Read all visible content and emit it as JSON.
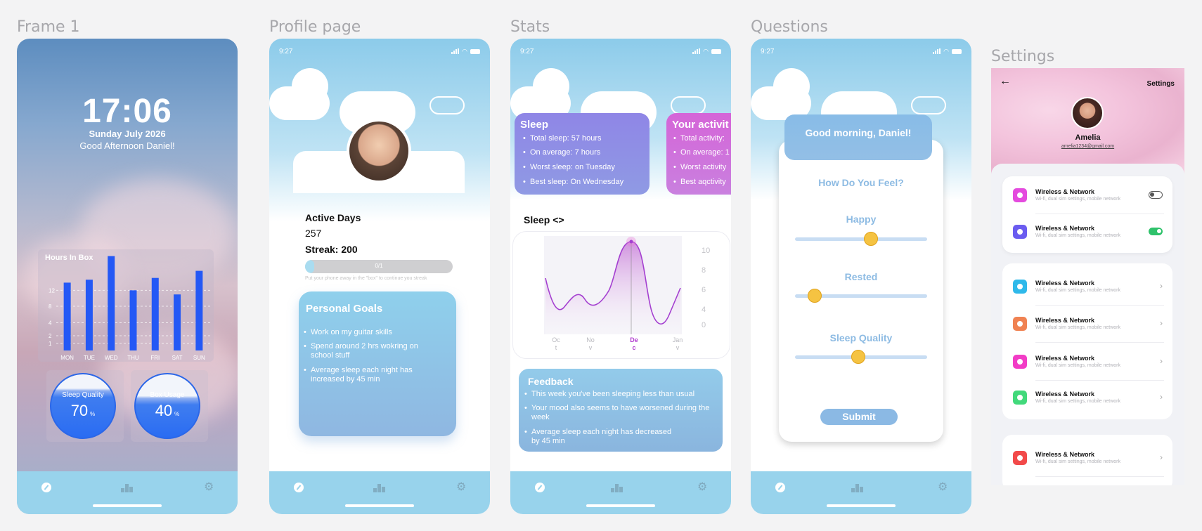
{
  "frames": {
    "frame1": "Frame 1",
    "profile": "Profile page",
    "stats": "Stats",
    "questions": "Questions",
    "settings": "Settings"
  },
  "status_time": "9:27",
  "frame1": {
    "time": "17:06",
    "date": "Sunday July 2026",
    "greeting": "Good Afternoon Daniel!",
    "chart_title": "Hours In Box",
    "gauges": [
      {
        "label": "Sleep Quality",
        "value": "70",
        "unit": "%",
        "fill": 0.7
      },
      {
        "label": "Box Usage",
        "value": "40",
        "unit": "%",
        "fill": 0.4
      }
    ]
  },
  "chart_data": [
    {
      "type": "bar",
      "title": "Hours In Box",
      "categories": [
        "MON",
        "TUE",
        "WED",
        "THU",
        "FRI",
        "SAT",
        "SUN"
      ],
      "values": [
        11.5,
        12,
        16,
        10.2,
        12.3,
        9.5,
        13.5
      ],
      "y_ticks": [
        "1",
        "2",
        "4",
        "8",
        "12"
      ],
      "grid": true
    },
    {
      "type": "line",
      "title": "Sleep <>",
      "categories": [
        "Oc\nt",
        "No\nv",
        "De\nc",
        "Jan\nv"
      ],
      "y_ticks": [
        "10",
        "8",
        "6",
        "4",
        "0"
      ],
      "highlight": "De\nc"
    }
  ],
  "profile": {
    "active_days_label": "Active Days",
    "active_days_value": "257",
    "streak": "Streak: 200",
    "progress_text": "0/1",
    "progress_fraction": 0.06,
    "hint": "Put your phone away in the \"box\" to continue you streak",
    "goals_title": "Personal Goals",
    "goals": [
      "Work on my guitar skills",
      "Spend around 2 hrs wokring on school stuff",
      "Average sleep each night has increased by 45 min"
    ]
  },
  "stats": {
    "sleep_card": {
      "title": "Sleep",
      "lines": [
        "Total sleep:  57 hours",
        "On average: 7 hours",
        "Worst sleep: on Tuesday",
        "Best sleep: On Wednesday"
      ]
    },
    "activity_card": {
      "title": "Your activit",
      "lines": [
        "Total activity:",
        "On average: 1",
        "Worst activity",
        "Best aqctivity"
      ]
    },
    "sleep_header": "Sleep <>",
    "feedback": {
      "title": "Feedback",
      "lines": [
        "This week you've been sleeping less than usual",
        "Your mood also seems to have worsened during the week",
        "Average sleep each night has decreased by 45 min"
      ]
    }
  },
  "questions": {
    "greeting": "Good morning, Daniel!",
    "prompt": "How Do You Feel?",
    "sliders": [
      {
        "label": "Happy",
        "value": 0.55
      },
      {
        "label": "Rested",
        "value": 0.1
      },
      {
        "label": "Sleep Quality",
        "value": 0.45
      }
    ],
    "submit": "Submit"
  },
  "settings": {
    "title": "Settings",
    "name": "Amelia",
    "email": "amelia1234@gmail.com",
    "rows": [
      {
        "title": "Wireless & Network",
        "subtitle": "Wi-fi, dual sim settings, mobile network",
        "color": "#e44bde",
        "control": "toggle-off"
      },
      {
        "title": "Wireless & Network",
        "subtitle": "Wi-fi, dual sim settings, mobile network",
        "color": "#6b5cf0",
        "control": "toggle-on"
      },
      {
        "title": "Wireless & Network",
        "subtitle": "Wi-fi, dual sim settings, mobile network",
        "color": "#2fb9ea",
        "control": "chevron"
      },
      {
        "title": "Wireless & Network",
        "subtitle": "Wi-fi, dual sim settings, mobile network",
        "color": "#f08252",
        "control": "chevron"
      },
      {
        "title": "Wireless & Network",
        "subtitle": "Wi-fi, dual sim settings, mobile network",
        "color": "#f23cc6",
        "control": "chevron"
      },
      {
        "title": "Wireless & Network",
        "subtitle": "Wi-fi, dual sim settings, mobile network",
        "color": "#42d97b",
        "control": "chevron"
      },
      {
        "title": "Wireless & Network",
        "subtitle": "Wi-fi, dual sim settings, mobile network",
        "color": "#f24a4a",
        "control": "chevron"
      }
    ]
  },
  "icons": [
    "compass-icon",
    "bar-chart-icon",
    "gear-icon",
    "back-arrow-icon",
    "chevron-right-icon",
    "wifi-icon",
    "bluetooth-icon"
  ]
}
